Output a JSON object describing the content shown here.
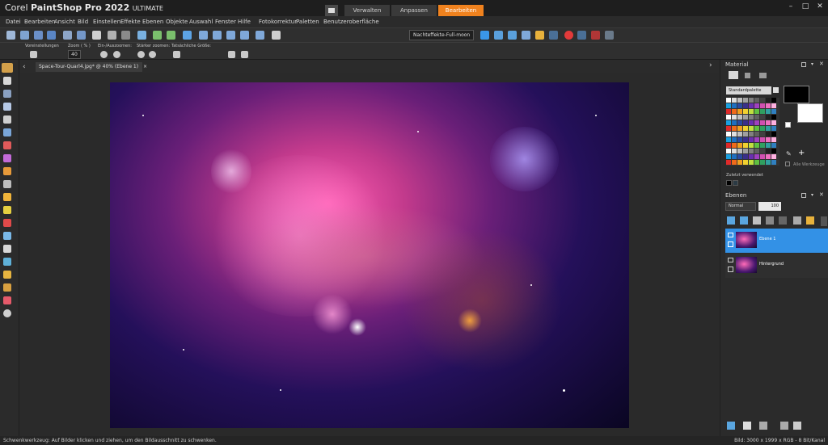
{
  "app": {
    "brand": "Corel",
    "name": "PaintShop",
    "name2": "Pro 2022",
    "edition": "ULTIMATE"
  },
  "workspaces": {
    "verwalten": "Verwalten",
    "anpassen": "Anpassen",
    "bearbeiten": "Bearbeiten"
  },
  "window_controls": {
    "minimize": "–",
    "maximize": "□",
    "close": "✕"
  },
  "menu": [
    "Datei",
    "Bearbeiten",
    "Ansicht",
    "Bild",
    "Einstellen",
    "Effekte",
    "Ebenen",
    "Objekte",
    "Auswahl",
    "Fenster",
    "Hilfe",
    "Fotokorrektur",
    "Paletten",
    "Benutzeroberfläche"
  ],
  "toolbar": {
    "preset": "Nachteffekte-Full-moon"
  },
  "options": {
    "presets_label": "Voreinstellungen",
    "zoom_label": "Zoom ( % )",
    "zoom_value": "40",
    "inout_label": "Ein-/Auszoomen:",
    "more_label": "Stärker zoomen:",
    "actual_label": "Tatsächliche Größe:"
  },
  "document": {
    "tab": "Space-Tour-Quarl4.jpg* @  40% (Ebene 1)",
    "close": "×"
  },
  "material": {
    "title": "Material",
    "palette_select": "Standardpalette",
    "all_tools": "Alle Werkzeuge",
    "recent_label": "Zuletzt verwendet",
    "foreground": "#000000",
    "background": "#ffffff"
  },
  "layers": {
    "title": "Ebenen",
    "blend": "Normal",
    "opacity": "100",
    "items": [
      {
        "name": "Ebene 1",
        "selected": true
      },
      {
        "name": "Hintergrund",
        "selected": false
      }
    ]
  },
  "status": {
    "left": "Schwenkwerkzeug: Auf Bilder klicken und ziehen, um den Bildausschnitt zu schwenken.",
    "right": "Bild: 3000 x 1999 x RGB - 8 Bit/Kanal"
  },
  "colors": {
    "accent": "#f0821e",
    "selection": "#3391e6"
  }
}
